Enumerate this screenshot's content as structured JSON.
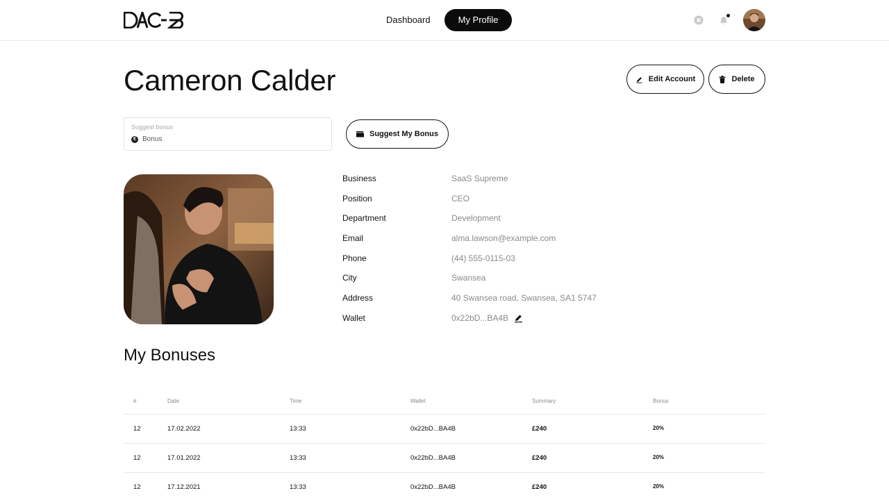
{
  "header": {
    "logo": "DAO-B",
    "nav": [
      {
        "label": "Dashboard",
        "active": false
      },
      {
        "label": "My Profile",
        "active": true
      }
    ],
    "icons": [
      "close-icon",
      "bell-icon"
    ],
    "avatar": "user-avatar"
  },
  "profile": {
    "name": "Cameron Calder",
    "edit_label": "Edit Account",
    "delete_label": "Delete",
    "suggest_field": {
      "label": "Suggest bonus",
      "value": "Bonus",
      "currency_symbol": "€"
    },
    "suggest_button": "Suggest My Bonus",
    "details": [
      {
        "key": "Business",
        "value": "SaaS Supreme"
      },
      {
        "key": "Position",
        "value": "CEO"
      },
      {
        "key": "Department",
        "value": "Development"
      },
      {
        "key": "Email",
        "value": "alma.lawson@example.com"
      },
      {
        "key": "Phone",
        "value": "(44) 555-0115-03"
      },
      {
        "key": "City",
        "value": "Swansea"
      },
      {
        "key": "Address",
        "value": "40 Swansea road, Swansea, SA1 5747"
      },
      {
        "key": "Wallet",
        "value": "0x22bD...BA4B"
      }
    ]
  },
  "bonuses": {
    "title": "My Bonuses",
    "columns": [
      "#",
      "Date",
      "Time",
      "Wallet",
      "Summary",
      "Bonus"
    ],
    "rows": [
      [
        "12",
        "17.02.2022",
        "13:33",
        "0x22bD...BA4B",
        "£240",
        "20%"
      ],
      [
        "12",
        "17.01.2022",
        "13:33",
        "0x22bD...BA4B",
        "£240",
        "20%"
      ],
      [
        "12",
        "17.12.2021",
        "13:33",
        "0x22bD...BA4B",
        "£240",
        "20%"
      ]
    ]
  },
  "colors": {
    "primary": "#0b0b0b",
    "muted_text": "#8a8a8a",
    "divider": "#e7e7e7"
  }
}
